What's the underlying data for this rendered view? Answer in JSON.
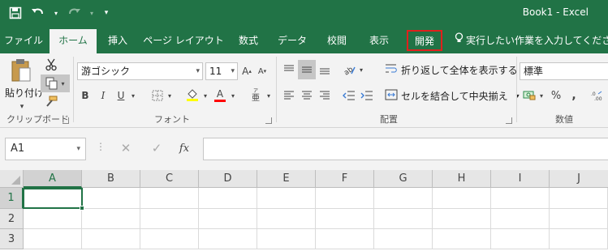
{
  "window": {
    "title": "Book1  -  Excel"
  },
  "quick_access": {
    "icons": [
      "save-icon",
      "undo-icon",
      "redo-icon",
      "customize-qat-icon"
    ]
  },
  "tabs": [
    {
      "label": "ファイル"
    },
    {
      "label": "ホーム"
    },
    {
      "label": "挿入"
    },
    {
      "label": "ページ レイアウト"
    },
    {
      "label": "数式"
    },
    {
      "label": "データ"
    },
    {
      "label": "校閲"
    },
    {
      "label": "表示"
    },
    {
      "label": "開発"
    }
  ],
  "active_tab": "ホーム",
  "highlighted_tab": "開発",
  "tell_me": {
    "text": "実行したい作業を入力してください"
  },
  "ribbon": {
    "clipboard": {
      "paste_label": "貼り付け",
      "group_label": "クリップボード"
    },
    "font": {
      "font_name": "游ゴシック",
      "font_size": "11",
      "group_label": "フォント",
      "bold": "B",
      "italic": "I",
      "underline": "U"
    },
    "alignment": {
      "wrap_text": "折り返して全体を表示する",
      "merge_center": "セルを結合して中央揃え",
      "group_label": "配置"
    },
    "number": {
      "format": "標準",
      "percent": "%",
      "comma": ",",
      "group_label": "数値"
    }
  },
  "formula_bar": {
    "name_box": "A1",
    "fx_label": "fx",
    "formula": ""
  },
  "grid": {
    "columns": [
      "A",
      "B",
      "C",
      "D",
      "E",
      "F",
      "G",
      "H",
      "I",
      "J"
    ],
    "rows": [
      "1",
      "2",
      "3"
    ],
    "active_cell": "A1"
  },
  "colors": {
    "brand_green": "#217346",
    "highlight_red": "#e0201c",
    "ribbon_bg": "#f3f3f3"
  }
}
